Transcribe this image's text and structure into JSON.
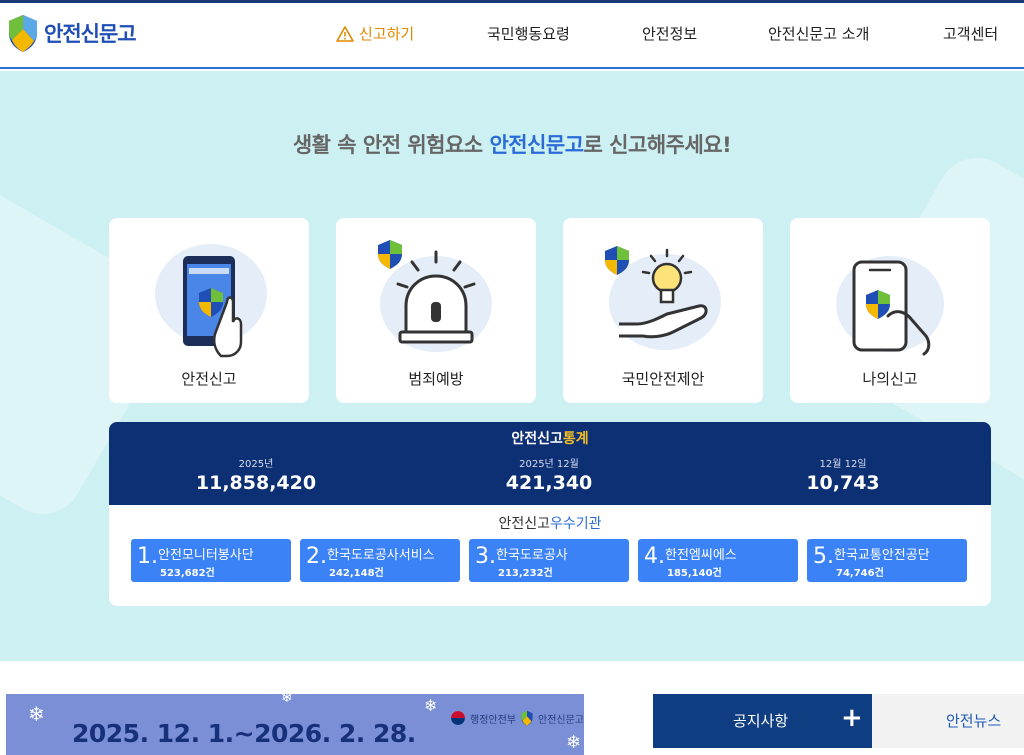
{
  "header": {
    "logo_text": "안전신문고",
    "nav": {
      "report": "신고하기",
      "guide": "국민행동요령",
      "info": "안전정보",
      "about": "안전신문고 소개",
      "support": "고객센터"
    }
  },
  "hero": {
    "headline_pre": "생활 속 안전 위험요소 ",
    "headline_accent": "안전신문고",
    "headline_post": "로 신고해주세요!",
    "cards": [
      {
        "label": "안전신고",
        "icon": "phone-touch-icon"
      },
      {
        "label": "범죄예방",
        "icon": "siren-icon"
      },
      {
        "label": "국민안전제안",
        "icon": "lightbulb-hand-icon"
      },
      {
        "label": "나의신고",
        "icon": "phone-hand-icon"
      }
    ]
  },
  "stats": {
    "title_pre": "안전신고",
    "title_accent": "통계",
    "items": [
      {
        "label": "2025년",
        "value": "11,858,420"
      },
      {
        "label": "2025년 12월",
        "value": "421,340"
      },
      {
        "label": "12월 12일",
        "value": "10,743"
      }
    ],
    "inst_title_pre": "안전신고",
    "inst_title_accent": "우수기관",
    "institutions": [
      {
        "rank": "1.",
        "name": "안전모니터봉사단",
        "count": "523,682건"
      },
      {
        "rank": "2.",
        "name": "한국도로공사서비스",
        "count": "242,148건"
      },
      {
        "rank": "3.",
        "name": "한국도로공사",
        "count": "213,232건"
      },
      {
        "rank": "4.",
        "name": "한전엠씨에스",
        "count": "185,140건"
      },
      {
        "rank": "5.",
        "name": "한국교통안전공단",
        "count": "74,746건"
      }
    ]
  },
  "bottom": {
    "banner_date": "2025. 12. 1.~2026. 2. 28.",
    "banner_org1": "행정안전부",
    "banner_org2": "안전신문고",
    "tab_notice": "공지사항",
    "tab_notice_plus": "+",
    "tab_news": "안전뉴스"
  },
  "colors": {
    "brand": "#1f4fb4",
    "accent_orange": "#e08a00",
    "hero_bg": "#cdf0f3",
    "stats_bg": "#0d2f73",
    "inst_blue": "#3b82f6"
  }
}
